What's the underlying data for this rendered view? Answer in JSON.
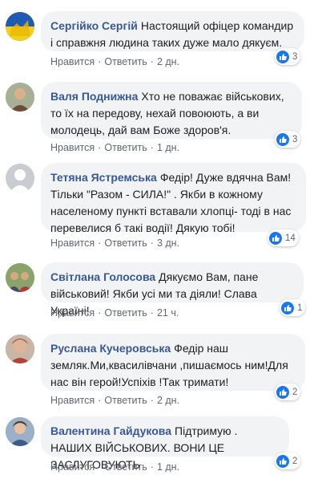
{
  "actions": {
    "like": "Нравится",
    "reply": "Ответить",
    "dot": "·"
  },
  "comments": [
    {
      "author": "Сергійко Сергій",
      "text": "Настоящий офіцер командир і справжня людина таких дуже мало дякуєм.",
      "time": "2 дн.",
      "likes": "3",
      "avatar": "flag-icon"
    },
    {
      "author": "Валя Поднижна",
      "text": "Хто не поважає військових, то їх на передову, нехай повоюють, а ви молодець, дай вам Боже здоров'я.",
      "time": "1 дн.",
      "likes": "3",
      "avatar": "user-photo"
    },
    {
      "author": "Тетяна Ястремська",
      "text": "Федір! Дуже вдячна Вам! Тільки \"Разом - СИЛА!\" . Якби в кожному населеному пункті вставали хлопці- тоді в нас перевелися б такі водії! Дякую тобі!",
      "time": "3 дн.",
      "likes": "14",
      "avatar": "default-avatar"
    },
    {
      "author": "Світлана Голосова",
      "text": "Дякуємо Вам, пане військовий! Якби усі ми та діяли! Слава Україні!",
      "time": "21 ч.",
      "likes": "1",
      "avatar": "user-photo"
    },
    {
      "author": "Руслана Кучеровська",
      "text": "Федір наш земляк.Ми,квасилівчани ,пишаємось ним!Для нас він герой!Успіхів !Так тримати!",
      "time": "2 дн.",
      "likes": "2",
      "avatar": "user-photo"
    },
    {
      "author": "Валентина Гайдукова",
      "text": "Підтримую . НАШИХ ВІЙСЬКОВИХ. ВОНИ ЦЕ ЗАСЛУГОВУЮТЬ",
      "time": "1 дн.",
      "likes": "2",
      "avatar": "user-photo"
    }
  ]
}
